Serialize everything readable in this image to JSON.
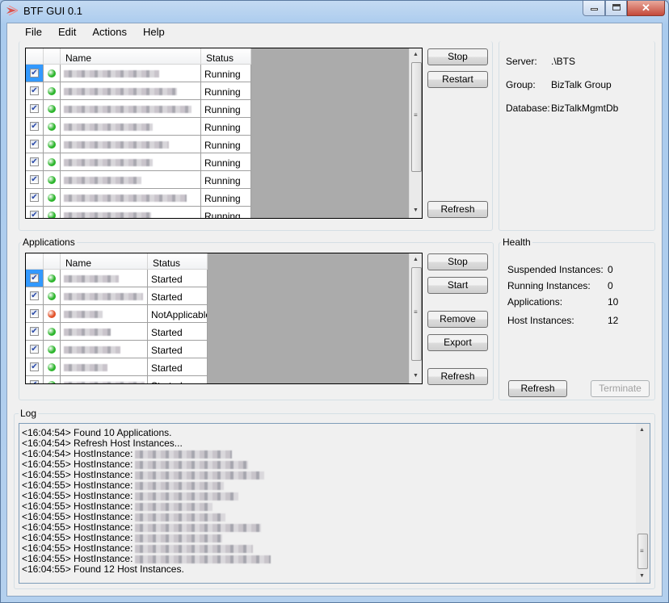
{
  "window": {
    "title": "BTF GUI 0.1"
  },
  "menu": [
    "File",
    "Edit",
    "Actions",
    "Help"
  ],
  "host_grid": {
    "columns": [
      "Name",
      "Status"
    ],
    "rows": [
      {
        "checked": true,
        "indicator": "green",
        "status": "Running"
      },
      {
        "checked": true,
        "indicator": "green",
        "status": "Running"
      },
      {
        "checked": true,
        "indicator": "green",
        "status": "Running"
      },
      {
        "checked": true,
        "indicator": "green",
        "status": "Running"
      },
      {
        "checked": true,
        "indicator": "green",
        "status": "Running"
      },
      {
        "checked": true,
        "indicator": "green",
        "status": "Running"
      },
      {
        "checked": true,
        "indicator": "green",
        "status": "Running"
      },
      {
        "checked": true,
        "indicator": "green",
        "status": "Running"
      },
      {
        "checked": true,
        "indicator": "green",
        "status": "Running"
      }
    ]
  },
  "host_buttons": {
    "stop": "Stop",
    "restart": "Restart",
    "refresh": "Refresh"
  },
  "server_info": {
    "server_label": "Server:",
    "server": ".\\BTS",
    "group_label": "Group:",
    "group": "BizTalk Group",
    "database_label": "Database:",
    "database": "BizTalkMgmtDb"
  },
  "applications": {
    "title": "Applications",
    "columns": [
      "Name",
      "Status"
    ],
    "rows": [
      {
        "checked": true,
        "indicator": "green",
        "status": "Started"
      },
      {
        "checked": true,
        "indicator": "green",
        "status": "Started"
      },
      {
        "checked": true,
        "indicator": "red",
        "status": "NotApplicable"
      },
      {
        "checked": true,
        "indicator": "green",
        "status": "Started"
      },
      {
        "checked": true,
        "indicator": "green",
        "status": "Started"
      },
      {
        "checked": true,
        "indicator": "green",
        "status": "Started"
      },
      {
        "checked": true,
        "indicator": "green",
        "status": "Started"
      }
    ],
    "buttons": {
      "stop": "Stop",
      "start": "Start",
      "remove": "Remove",
      "export": "Export",
      "refresh": "Refresh"
    }
  },
  "health": {
    "title": "Health",
    "items": [
      {
        "label": "Suspended Instances:",
        "value": "0"
      },
      {
        "label": "Running Instances:",
        "value": "0"
      },
      {
        "label": "Applications:",
        "value": "10"
      },
      {
        "label": "Host Instances:",
        "value": "12"
      }
    ],
    "refresh": "Refresh",
    "terminate": "Terminate"
  },
  "log": {
    "title": "Log",
    "lines": [
      "<16:04:54> Found 10 Applications.",
      "<16:04:54> Refresh Host Instances...",
      "<16:04:54> HostInstance:",
      "<16:04:55> HostInstance:",
      "<16:04:55> HostInstance:",
      "<16:04:55> HostInstance:",
      "<16:04:55> HostInstance:",
      "<16:04:55> HostInstance:",
      "<16:04:55> HostInstance:",
      "<16:04:55> HostInstance:",
      "<16:04:55> HostInstance:",
      "<16:04:55> HostInstance:",
      "<16:04:55> HostInstance:",
      "<16:04:55> Found 12 Host Instances."
    ]
  },
  "colors": {
    "green": "#2cb52c",
    "red": "#e2522a",
    "selection": "#3399ff"
  }
}
